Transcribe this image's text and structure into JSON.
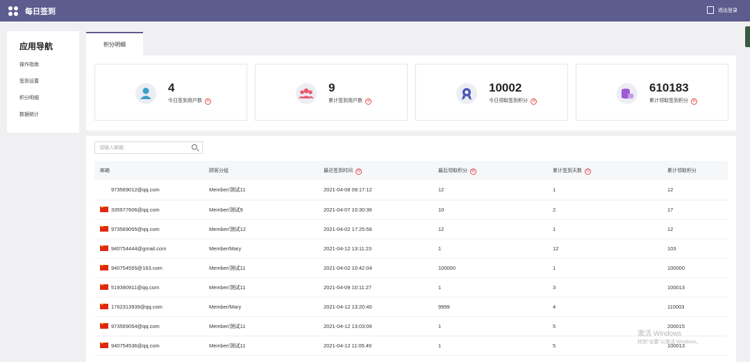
{
  "header": {
    "title": "每日签到",
    "logout_label": "退出登录"
  },
  "sidebar": {
    "title": "应用导航",
    "items": [
      {
        "label": "操作指南"
      },
      {
        "label": "签到设置"
      },
      {
        "label": "积分明细"
      },
      {
        "label": "数据统计"
      }
    ]
  },
  "tabs": [
    {
      "label": "积分明细"
    }
  ],
  "stats": [
    {
      "value": "4",
      "label": "今日签到用户数",
      "marker": "①",
      "icon": "user-icon",
      "color": "#3aa0c8"
    },
    {
      "value": "9",
      "label": "累计签到用户数",
      "marker": "②",
      "icon": "users-icon",
      "color": "#e8596e"
    },
    {
      "value": "10002",
      "label": "今日领取签到积分",
      "marker": "③",
      "icon": "award-icon",
      "color": "#4a56b8"
    },
    {
      "value": "610183",
      "label": "累计领取签到积分",
      "marker": "④",
      "icon": "coins-icon",
      "color": "#9b5ad6"
    }
  ],
  "search": {
    "placeholder": "请输入邮箱"
  },
  "table": {
    "headers": [
      {
        "label": "邮箱",
        "marker": ""
      },
      {
        "label": "顾客分组",
        "marker": ""
      },
      {
        "label": "最近签到时间",
        "marker": "⑤"
      },
      {
        "label": "最后领取积分",
        "marker": "⑥"
      },
      {
        "label": "累计签到天数",
        "marker": "⑦"
      },
      {
        "label": "累计领取积分",
        "marker": ""
      }
    ],
    "rows": [
      {
        "flag": false,
        "email": "973569012@qq.com",
        "group": "Member/测试11",
        "time": "2021-04-08 09:17:12",
        "last": "12",
        "days": "1",
        "total": "12"
      },
      {
        "flag": true,
        "email": "335977606@qq.com",
        "group": "Member/测试9",
        "time": "2021-04-07 10:30:36",
        "last": "10",
        "days": "2",
        "total": "17"
      },
      {
        "flag": true,
        "email": "973569055@qq.com",
        "group": "Member/测试12",
        "time": "2021-04-02 17:25:56",
        "last": "12",
        "days": "1",
        "total": "12"
      },
      {
        "flag": true,
        "email": "940754444@gmail.com",
        "group": "Member/Mary",
        "time": "2021-04-12 13:11:23",
        "last": "1",
        "days": "12",
        "total": "103"
      },
      {
        "flag": true,
        "email": "940754555@163.com",
        "group": "Member/测试11",
        "time": "2021-04-02 10:42:04",
        "last": "100000",
        "days": "1",
        "total": "100000"
      },
      {
        "flag": true,
        "email": "519390911@qq.com",
        "group": "Member/测试11",
        "time": "2021-04-09 10:11:27",
        "last": "1",
        "days": "3",
        "total": "100013"
      },
      {
        "flag": true,
        "email": "1762313939@qq.com",
        "group": "Member/Mary",
        "time": "2021-04-12 13:20:40",
        "last": "9999",
        "days": "4",
        "total": "110003"
      },
      {
        "flag": true,
        "email": "973569054@qq.com",
        "group": "Member/测试11",
        "time": "2021-04-12 13:03:06",
        "last": "1",
        "days": "5",
        "total": "200015"
      },
      {
        "flag": true,
        "email": "940754536@qq.com",
        "group": "Member/测试11",
        "time": "2021-04-12 11:05:49",
        "last": "1",
        "days": "5",
        "total": "100013"
      }
    ]
  },
  "watermark": {
    "line1": "激活 Windows",
    "line2": "转到\"设置\"以激活 Windows。"
  }
}
